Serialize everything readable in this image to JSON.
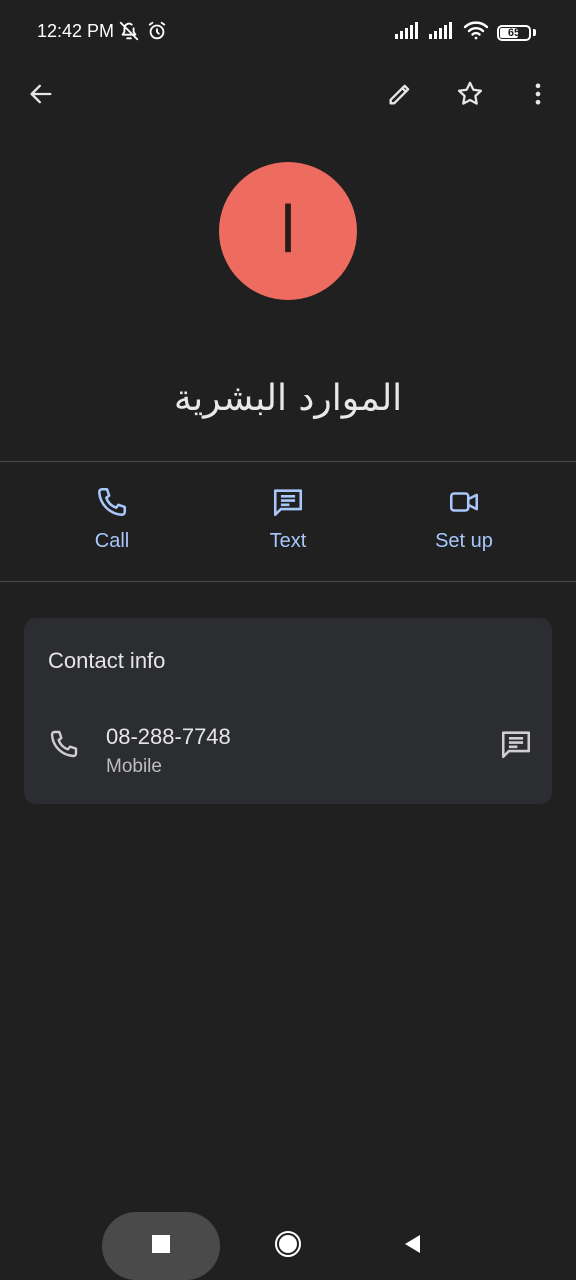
{
  "status_bar": {
    "time": "12:42 PM",
    "battery": "65",
    "battery_level_percent": 65,
    "icons": [
      "mute-notifications-icon",
      "alarm-icon",
      "signal-icon",
      "signal-icon",
      "wifi-icon",
      "battery-icon"
    ]
  },
  "app_bar": {
    "icons": [
      "back-arrow-icon",
      "edit-pencil-icon",
      "star-icon",
      "more-vert-icon"
    ]
  },
  "contact": {
    "avatar_letter": "ا",
    "avatar_color": "#ee6b60",
    "name": "الموارد البشرية"
  },
  "actions": {
    "call_label": "Call",
    "text_label": "Text",
    "setup_label": "Set up",
    "accent_color": "#a8c7fa"
  },
  "contact_info": {
    "title": "Contact info",
    "phone_number": "08-288-7748",
    "phone_type": "Mobile"
  },
  "nav_bar": {
    "icons": [
      "recents-square-icon",
      "home-circle-icon",
      "back-triangle-icon"
    ]
  }
}
